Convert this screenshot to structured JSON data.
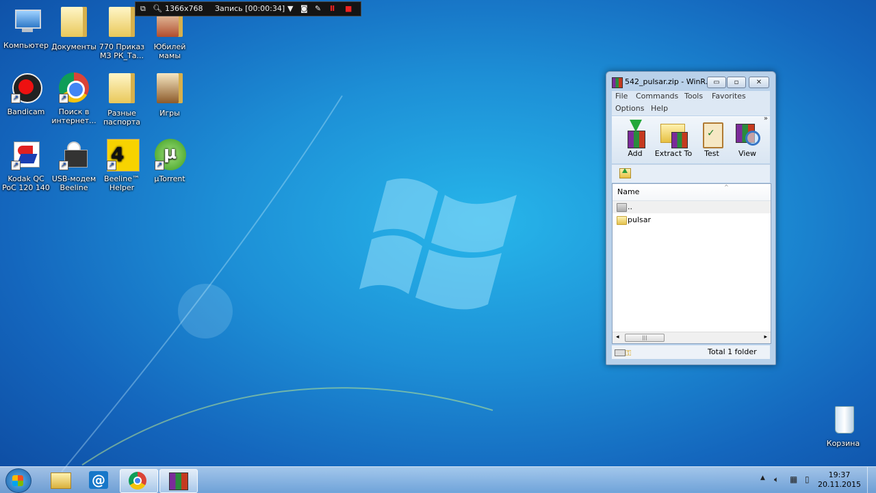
{
  "desktop": {
    "icons": [
      {
        "label": "Компьютер"
      },
      {
        "label": "Документы"
      },
      {
        "label": "770 Приказ МЗ РК_Та..."
      },
      {
        "label": "Юбилей мамы"
      },
      {
        "label": "Bandicam"
      },
      {
        "label": "Поиск в интернет..."
      },
      {
        "label": "Разные паспорта"
      },
      {
        "label": "Игры"
      },
      {
        "label": "Kodak QC PoC 120 140"
      },
      {
        "label": "USB-модем Beeline"
      },
      {
        "label": "Beeline™ Helper"
      },
      {
        "label": "µTorrent"
      }
    ],
    "recycle_bin": {
      "label": "Корзина"
    }
  },
  "recorder": {
    "resolution": "1366x768",
    "status": "Запись [00:00:34]"
  },
  "winrar": {
    "title": "542_pulsar.zip - WinR...",
    "controls": {
      "minimize": "▭",
      "maximize": "▫",
      "close": "✕"
    },
    "menu": [
      "File",
      "Commands",
      "Tools",
      "Favorites",
      "Options",
      "Help"
    ],
    "toolbar": [
      "Add",
      "Extract To",
      "Test",
      "View"
    ],
    "toolbar_more": "»",
    "list": {
      "column": "Name",
      "rows": [
        {
          "name": ".."
        },
        {
          "name": "pulsar"
        }
      ]
    },
    "scroll_grip": "|||",
    "status": "Total 1 folder"
  },
  "taskbar": {
    "clock_time": "19:37",
    "clock_date": "20.11.2015"
  },
  "icons": {
    "start": "windows-orb",
    "explorer": "folder",
    "mail": "at-sign",
    "chrome": "chrome",
    "winrar": "winrar"
  },
  "colors": {
    "desktop": "#1d8fd6",
    "window_frame": "#b9d1ea",
    "accent": "#1a55c4"
  }
}
